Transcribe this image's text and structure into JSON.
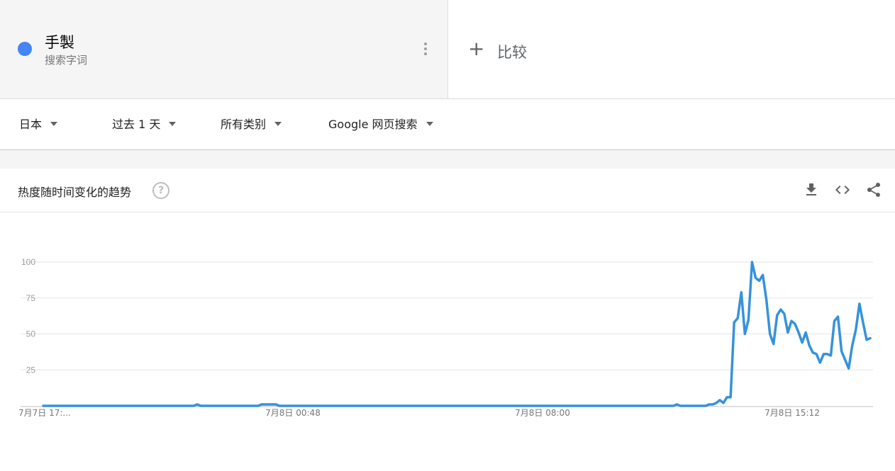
{
  "term": {
    "name": "手製",
    "type": "搜索字词",
    "color": "#4285f4"
  },
  "compare": {
    "label": "比较"
  },
  "filters": {
    "region": "日本",
    "time": "过去 1 天",
    "category": "所有类别",
    "search_type": "Google 网页搜索"
  },
  "card": {
    "title": "热度随时间变化的趋势"
  },
  "chart_data": {
    "type": "line",
    "title": "",
    "xlabel": "",
    "ylabel": "",
    "ylim": [
      0,
      100
    ],
    "yticks": [
      25,
      50,
      75,
      100
    ],
    "grid": true,
    "x_tick_labels": [
      "7月7日 17:...",
      "7月8日 00:48",
      "7月8日 08:00",
      "7月8日 15:12"
    ],
    "series": [
      {
        "name": "手製",
        "color": "#3592db",
        "values": [
          0,
          0,
          0,
          0,
          0,
          0,
          0,
          0,
          0,
          0,
          0,
          0,
          0,
          0,
          0,
          0,
          0,
          0,
          0,
          0,
          0,
          0,
          0,
          0,
          0,
          0,
          0,
          0,
          0,
          0,
          0,
          0,
          0,
          0,
          0,
          0,
          0,
          0,
          0,
          0,
          0,
          0,
          0,
          1,
          0,
          0,
          0,
          0,
          0,
          0,
          0,
          0,
          0,
          0,
          0,
          0,
          0,
          0,
          0,
          0,
          0,
          1,
          1,
          1,
          1,
          1,
          0,
          0,
          0,
          0,
          0,
          0,
          0,
          0,
          0,
          0,
          0,
          0,
          0,
          0,
          0,
          0,
          0,
          0,
          0,
          0,
          0,
          0,
          0,
          0,
          0,
          0,
          0,
          0,
          0,
          0,
          0,
          0,
          0,
          0,
          0,
          0,
          0,
          0,
          0,
          0,
          0,
          0,
          0,
          0,
          0,
          0,
          0,
          0,
          0,
          0,
          0,
          0,
          0,
          0,
          0,
          0,
          0,
          0,
          0,
          0,
          0,
          0,
          0,
          0,
          0,
          0,
          0,
          0,
          0,
          0,
          0,
          0,
          0,
          0,
          0,
          0,
          0,
          0,
          0,
          0,
          0,
          0,
          0,
          0,
          0,
          0,
          0,
          0,
          0,
          0,
          0,
          0,
          0,
          0,
          0,
          0,
          0,
          0,
          0,
          0,
          0,
          0,
          0,
          0,
          0,
          0,
          0,
          0,
          0,
          0,
          0,
          1,
          0,
          0,
          0,
          0,
          0,
          0,
          0,
          0,
          1,
          1,
          2,
          4,
          2,
          6,
          6,
          58,
          61,
          79,
          50,
          60,
          100,
          89,
          87,
          91,
          74,
          50,
          43,
          63,
          67,
          64,
          51,
          59,
          57,
          51,
          44,
          51,
          42,
          37,
          36,
          30,
          36,
          36,
          35,
          59,
          62,
          38,
          32,
          26,
          42,
          53,
          71,
          58,
          46,
          47
        ]
      }
    ]
  }
}
